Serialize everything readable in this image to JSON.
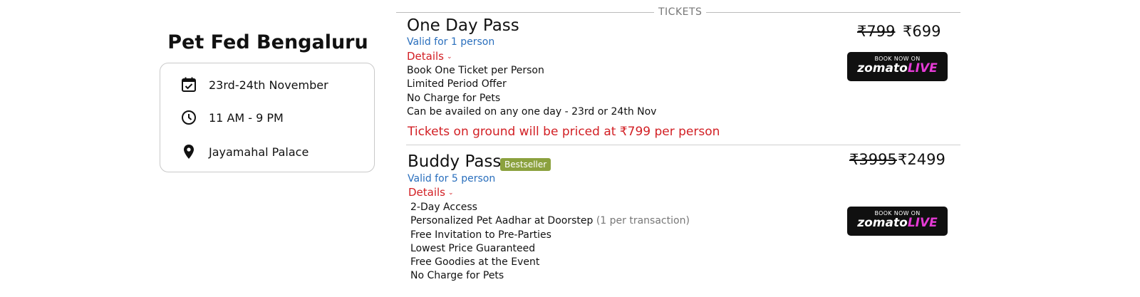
{
  "event": {
    "title": "Pet Fed Bengaluru",
    "date": "23rd-24th November",
    "time": "11 AM - 9 PM",
    "venue": "Jayamahal Palace",
    "icons": [
      "calendar-check-icon",
      "clock-icon",
      "location-pin-icon"
    ]
  },
  "tickets_label": "TICKETS",
  "tickets": [
    {
      "name": "One Day Pass",
      "valid": "Valid for 1 person",
      "details_label": "Details",
      "features": [
        "Book One Ticket per Person",
        "Limited Period Offer",
        "No Charge for Pets",
        "Can be availed on any one day - 23rd or 24th Nov"
      ],
      "warning": "Tickets on ground will be priced at ₹799 per person",
      "price_old": "₹799",
      "price_new": "₹699",
      "book_small": "BOOK NOW ON",
      "book_brand": "zomato",
      "book_brand_live": "LIVE"
    },
    {
      "name": "Buddy Pass",
      "badge": "Bestseller",
      "valid": "Valid for 5 person",
      "details_label": "Details",
      "features": [
        "2-Day Access",
        "Personalized Pet Aadhar at Doorstep",
        "Free Invitation to Pre-Parties",
        "Lowest Price Guaranteed",
        "Free Goodies at the Event",
        "No Charge for Pets"
      ],
      "feature_note": "(1 per transaction)",
      "price_old": "₹3995",
      "price_new": "₹2499",
      "book_small": "BOOK NOW ON",
      "book_brand": "zomato",
      "book_brand_live": "LIVE"
    }
  ],
  "colors": {
    "accent_red": "#d21f24",
    "link_blue": "#2a6fbd",
    "badge_green": "#8ba13e",
    "button_bg": "#101010",
    "live_pink": "#e63bd6"
  }
}
